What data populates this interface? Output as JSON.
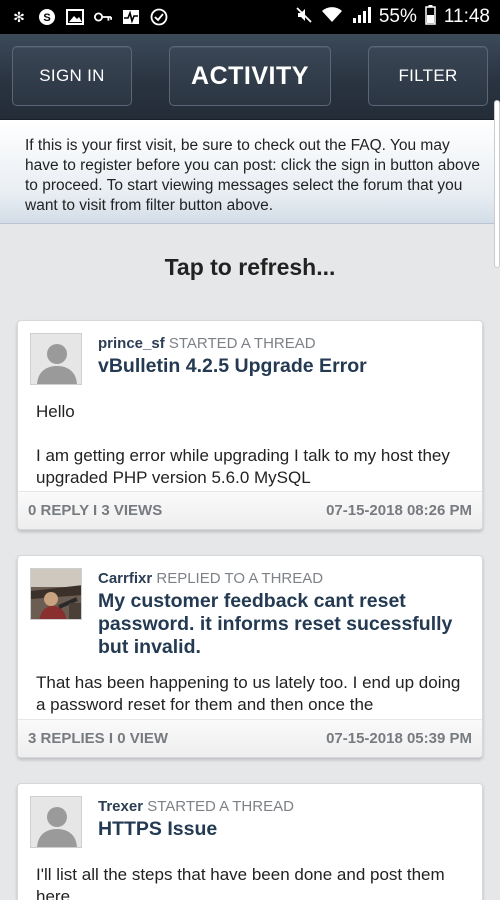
{
  "statusbar": {
    "battery": "55%",
    "time": "11:48"
  },
  "nav": {
    "sign_in": "SIGN IN",
    "activity": "ACTIVITY",
    "filter": "FILTER"
  },
  "notice": "If this is your first visit, be sure to check out the FAQ. You may have to register before you can post: click the sign in button above to proceed. To start viewing messages select the forum that you want to visit from filter button above.",
  "refresh_label": "Tap to refresh...",
  "posts": [
    {
      "user": "prince_sf",
      "action": " STARTED A THREAD",
      "title": "vBulletin 4.2.5 Upgrade Error",
      "body1": "Hello",
      "body2": "I am getting error while upgrading  I talk to my host they upgraded PHP version 5.6.0  MySQL",
      "stats": "0 REPLY I 3 VIEWS",
      "date": "07-15-2018 08:26 PM"
    },
    {
      "user": "Carrfixr",
      "action": " REPLIED TO A THREAD",
      "title": "My customer feedback cant reset password. it informs reset sucessfully but invalid.",
      "body1": "That has been happening to us lately too. I end up doing a password reset for them and then once the",
      "stats": "3 REPLIES I 0 VIEW",
      "date": "07-15-2018 05:39 PM"
    },
    {
      "user": "Trexer",
      "action": " STARTED A THREAD",
      "title": "HTTPS Issue",
      "body1": "I'll list all the steps that have been done and post them here."
    }
  ]
}
